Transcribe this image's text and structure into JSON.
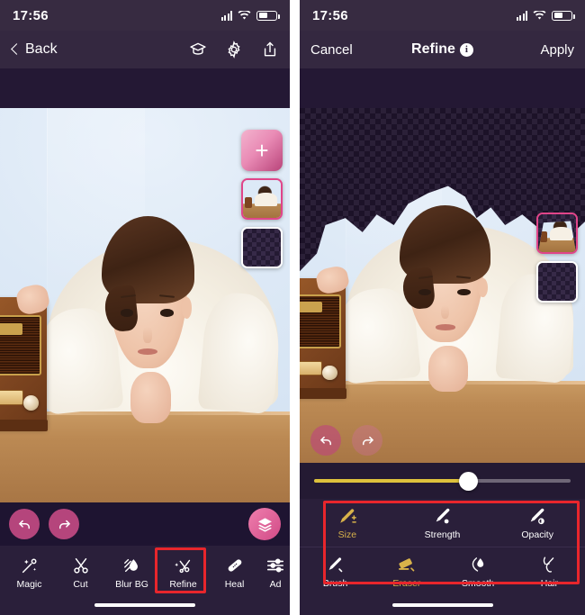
{
  "left_panel": {
    "status": {
      "time": "17:56",
      "signal_icon": "cellular-signal-icon",
      "wifi_icon": "wifi-icon",
      "battery_icon": "battery-icon"
    },
    "nav": {
      "back_label": "Back",
      "back_icon": "chevron-left-icon",
      "actions": [
        {
          "name": "graduation-cap-icon",
          "label": "Tutorial"
        },
        {
          "name": "gear-icon",
          "label": "Settings"
        },
        {
          "name": "share-icon",
          "label": "Share"
        }
      ]
    },
    "layers": [
      {
        "type": "add",
        "name": "add-layer-button",
        "glyph": "+",
        "selected": false
      },
      {
        "type": "photo",
        "name": "layer-thumb-photo",
        "selected": true
      },
      {
        "type": "transparent",
        "name": "layer-thumb-transparent",
        "selected": false
      }
    ],
    "actions": [
      {
        "name": "undo-button",
        "icon": "undo-icon"
      },
      {
        "name": "redo-button",
        "icon": "redo-icon"
      },
      {
        "name": "layers-button",
        "icon": "layers-icon"
      }
    ],
    "toolbar": [
      {
        "label": "Magic",
        "icon": "magic-cut-icon",
        "highlighted": false
      },
      {
        "label": "Cut",
        "icon": "scissors-icon",
        "highlighted": false
      },
      {
        "label": "Blur BG",
        "icon": "blur-drop-icon",
        "highlighted": false
      },
      {
        "label": "Refine",
        "icon": "refine-scissors-icon",
        "highlighted": true
      },
      {
        "label": "Heal",
        "icon": "bandage-icon",
        "highlighted": false
      },
      {
        "label": "Ad",
        "icon": "adjust-sliders-icon",
        "highlighted": false
      }
    ]
  },
  "right_panel": {
    "status": {
      "time": "17:56",
      "signal_icon": "cellular-signal-icon",
      "wifi_icon": "wifi-icon",
      "battery_icon": "battery-icon"
    },
    "nav": {
      "cancel_label": "Cancel",
      "title": "Refine",
      "info_glyph": "i",
      "apply_label": "Apply"
    },
    "layers": [
      {
        "type": "photo",
        "name": "layer-thumb-photo",
        "selected": true
      },
      {
        "type": "transparent",
        "name": "layer-thumb-transparent",
        "selected": false
      }
    ],
    "actions": [
      {
        "name": "undo-button",
        "icon": "undo-icon"
      },
      {
        "name": "redo-button",
        "icon": "redo-icon"
      }
    ],
    "slider": {
      "name": "brush-size-slider",
      "value_percent": 60,
      "fill_color": "#ddc13c",
      "track_color": "#6f6777"
    },
    "tools_row1": [
      {
        "label": "Size",
        "icon": "brush-size-icon",
        "active": true
      },
      {
        "label": "Strength",
        "icon": "brush-strength-icon",
        "active": false
      },
      {
        "label": "Opacity",
        "icon": "brush-opacity-icon",
        "active": false
      }
    ],
    "tools_row2": [
      {
        "label": "Brush",
        "icon": "brush-icon",
        "active": false
      },
      {
        "label": "Eraser",
        "icon": "eraser-icon",
        "active": true
      },
      {
        "label": "Smooth",
        "icon": "smooth-drop-icon",
        "active": false
      },
      {
        "label": "Hair",
        "icon": "hair-strand-icon",
        "active": false
      }
    ]
  },
  "colors": {
    "background_purple": "#1e1228",
    "statusbar_purple": "#372b41",
    "navbar_purple": "#342840",
    "toolbar_purple": "#2a1f3a",
    "accent_pink": "#b5457c",
    "accent_gold": "#d8b24a",
    "highlight_red": "#e8262c",
    "selected_border_pink": "#e0458a"
  }
}
